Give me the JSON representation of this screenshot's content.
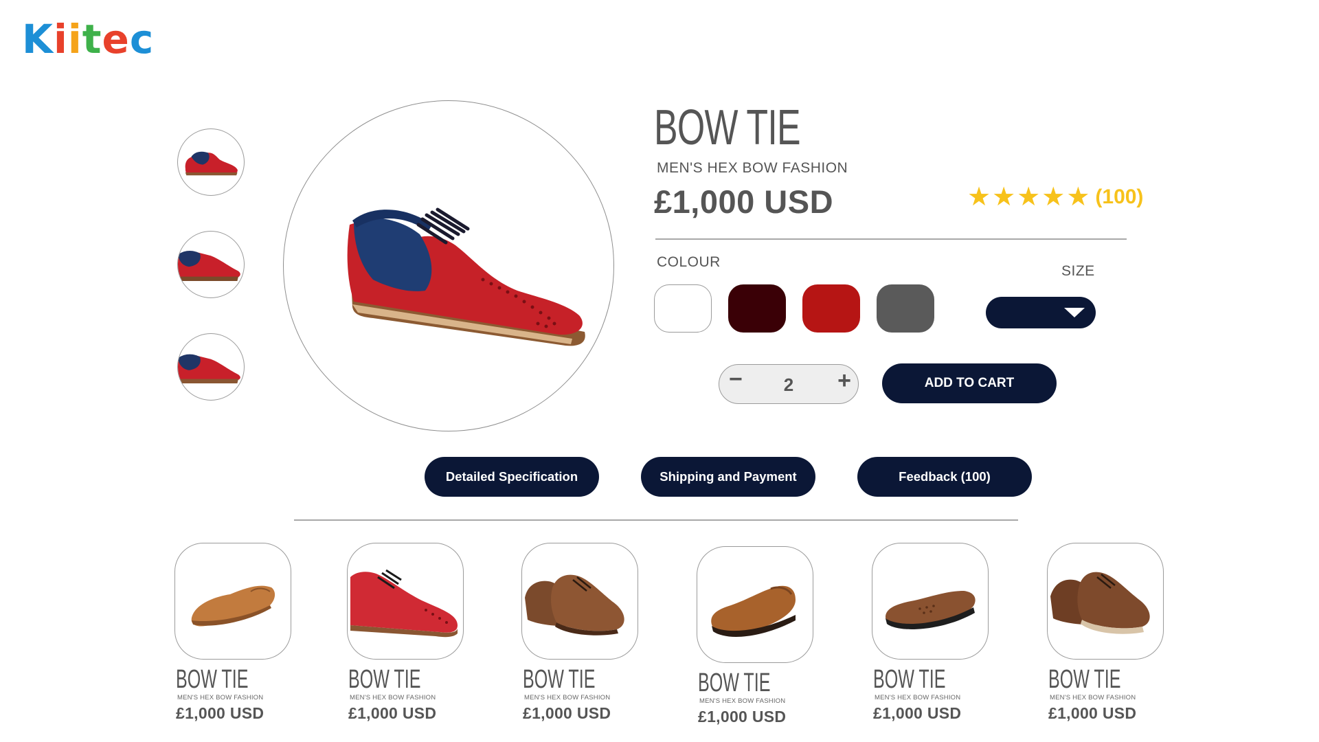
{
  "brand": {
    "logo_letters": [
      "K",
      "i",
      "i",
      "t",
      "e",
      "c"
    ],
    "logo_colors": [
      "#1d8fd6",
      "#e8412b",
      "#f5a31a",
      "#3eb14a",
      "#e8412b",
      "#1d8fd6"
    ]
  },
  "product": {
    "title": "BOW TIE",
    "subtitle": "MEN'S HEX BOW FASHION",
    "price": "£1,000 USD",
    "rating": 5,
    "rating_count": "(100)",
    "colour_label": "COLOUR",
    "size_label": "SIZE",
    "colours": [
      "#ffffff",
      "#3a0006",
      "#b61514",
      "#5a5a5a"
    ],
    "quantity": "2",
    "minus_symbol": "−",
    "plus_symbol": "+",
    "add_to_cart": "ADD TO CART"
  },
  "tabs": [
    {
      "label": "Detailed Specification"
    },
    {
      "label": "Shipping and Payment"
    },
    {
      "label": "Feedback (100)"
    }
  ],
  "related": [
    {
      "title": "BOW TIE",
      "subtitle": "MEN'S HEX BOW FASHION",
      "price": "£1,000 USD",
      "shoe": "tan-loafer"
    },
    {
      "title": "BOW TIE",
      "subtitle": "MEN'S HEX BOW FASHION",
      "price": "£1,000 USD",
      "shoe": "red-brogue"
    },
    {
      "title": "BOW TIE",
      "subtitle": "MEN'S HEX BOW FASHION",
      "price": "£1,000 USD",
      "shoe": "brown-brogue-pair"
    },
    {
      "title": "BOW TIE",
      "subtitle": "MEN'S HEX BOW FASHION",
      "price": "£1,000 USD",
      "shoe": "tan-slip-on"
    },
    {
      "title": "BOW TIE",
      "subtitle": "MEN'S HEX BOW FASHION",
      "price": "£1,000 USD",
      "shoe": "brown-moccasin"
    },
    {
      "title": "BOW TIE",
      "subtitle": "MEN'S HEX BOW FASHION",
      "price": "£1,000 USD",
      "shoe": "brown-derby-pair"
    }
  ]
}
